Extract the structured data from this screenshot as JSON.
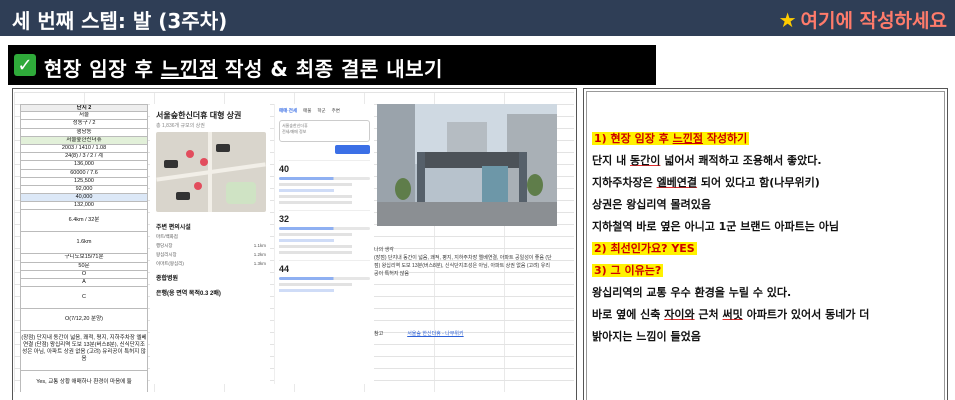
{
  "header": {
    "title": "세 번째 스텝: 발 (3주차)",
    "cta_star": "★",
    "cta": "여기에 작성하세요"
  },
  "section": {
    "check": "✓",
    "title_before": "현장 임장 후 ",
    "title_underlined": "느낀점",
    "title_after": " 작성 & 최종 결론 내보기"
  },
  "sheet": {
    "header": "단지 2",
    "rows": [
      "서울",
      "성동구 / 2",
      "행당동",
      "서울숲한신더휴",
      "2003 / 1410 / 1.08",
      "24(8) / 3 / 2 / 계",
      "136,000",
      "60000 / 7.6",
      "125,500",
      "92,000",
      "40,000",
      "132,000",
      "6.4km / 32분",
      "1.6km",
      "구디도보15/71분",
      "50문",
      "O",
      "A",
      "C",
      "O(7/12,20 분양)"
    ],
    "note": "(장점) 단지내 동간이 넓음, 쾌적, 평지, 지하주차장 엘베연결 (단점) 왕십리역 도보 13분(버스8분), 신식단지조성은 아님, 아파트 상권 없음 (고려) 유리공이 특허지 않음",
    "yes_label": "Yes,",
    "yes_note": "교통 상황 애매하나 환경이 마음에 듦"
  },
  "map_panel": {
    "title": "서울숲한신더휴 대형 상권",
    "subtitle": "총 1,836개 규모의 상권",
    "section_label": "주변 편의시설",
    "list": [
      [
        "마트/백화점",
        ""
      ],
      [
        "행당시장",
        "1.1km"
      ],
      [
        "왕십리시장",
        "1.2km"
      ],
      [
        "이마트(왕십리)",
        "1.3km"
      ]
    ],
    "section2": "종합병원",
    "section3": "은행(응 면역 목적0.3 2배)"
  },
  "price_panel": {
    "tabs": [
      "매매·전세",
      "매물",
      "학군",
      "주변"
    ],
    "search_hint": "서울숲한신더휴",
    "search_sub": "전세/매매 정보",
    "block1_big": "40",
    "block2_big": "32",
    "block3_big": "44"
  },
  "notes": {
    "heading": "나의 생각",
    "text": "(장점) 단지내 동간이 넓음, 쾌적, 평지, 지하주차장 엘베연결, 아파트 공일성이 좋음 (단점) 왕십리역 도보 13분(버스8분), 신식단지조성은 아님, 아파트 상권 없음 (고려) 유리공이 특허지 않음",
    "ref_label": "참고",
    "ref_link": "서울숲 한신더휴 - 나무위키"
  },
  "right": {
    "q1_num": "1) 현장 임장 후 ",
    "q1_u": "느낀점",
    "q1_after": " 작성하기",
    "line1_a": "단지 내 ",
    "line1_u": "동간이",
    "line1_b": " 넓어서 쾌적하고 조용해서 좋았다.",
    "line2_a": "지하주차장은 ",
    "line2_u": "엘베연결",
    "line2_b": " 되어 있다고 함(나무위키)",
    "line3": "상권은 왕십리역 몰려있음",
    "line4": "지하철역 바로 옆은 아니고 1군 브랜드 아파트는 아님",
    "q2": "2) 최선인가요? YES",
    "q3": "3) 그 이유는?",
    "line5": "왕십리역의 교통 우수 환경을 누릴 수 있다.",
    "line6_a": "바로 옆에 신축 ",
    "line6_u1": "자이와",
    "line6_b": " 근처 ",
    "line6_u2": "써밋",
    "line6_c": " 아파트가 있어서 동네가 더",
    "line7": "밝아지는 느낌이 들었음"
  },
  "colors": {
    "topbar": "#2f3e56",
    "cta": "#ff7b6b",
    "highlight": "#fff200",
    "check": "#2faa3a"
  }
}
